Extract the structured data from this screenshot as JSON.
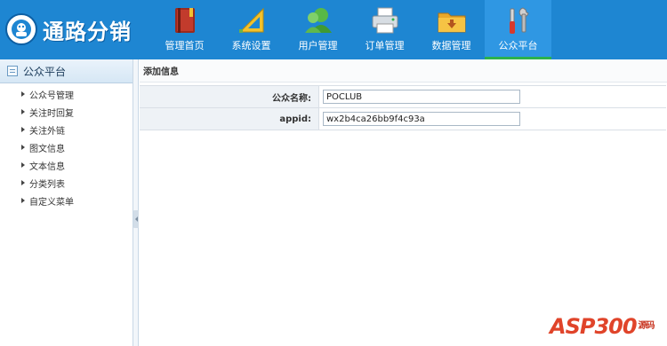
{
  "header": {
    "brand": "通路分销",
    "nav": [
      {
        "label": "管理首页",
        "icon": "book-icon"
      },
      {
        "label": "系统设置",
        "icon": "ruler-icon"
      },
      {
        "label": "用户管理",
        "icon": "users-icon"
      },
      {
        "label": "订单管理",
        "icon": "printer-icon"
      },
      {
        "label": "数据管理",
        "icon": "folder-icon"
      },
      {
        "label": "公众平台",
        "icon": "tools-icon",
        "active": true
      }
    ]
  },
  "sidebar": {
    "title": "公众平台",
    "items": [
      "公众号管理",
      "关注时回复",
      "关注外链",
      "图文信息",
      "文本信息",
      "分类列表",
      "自定义菜单"
    ]
  },
  "main": {
    "title": "添加信息",
    "fields": [
      {
        "label": "公众名称:",
        "value": "POCLUB"
      },
      {
        "label": "appid:",
        "value": "wx2b4ca26bb9f4c93a"
      }
    ]
  },
  "watermark": {
    "text": "ASP300",
    "sub": "源码"
  },
  "colors": {
    "header_bg": "#1e86d2",
    "active_tab_underline": "#2bb24c"
  }
}
